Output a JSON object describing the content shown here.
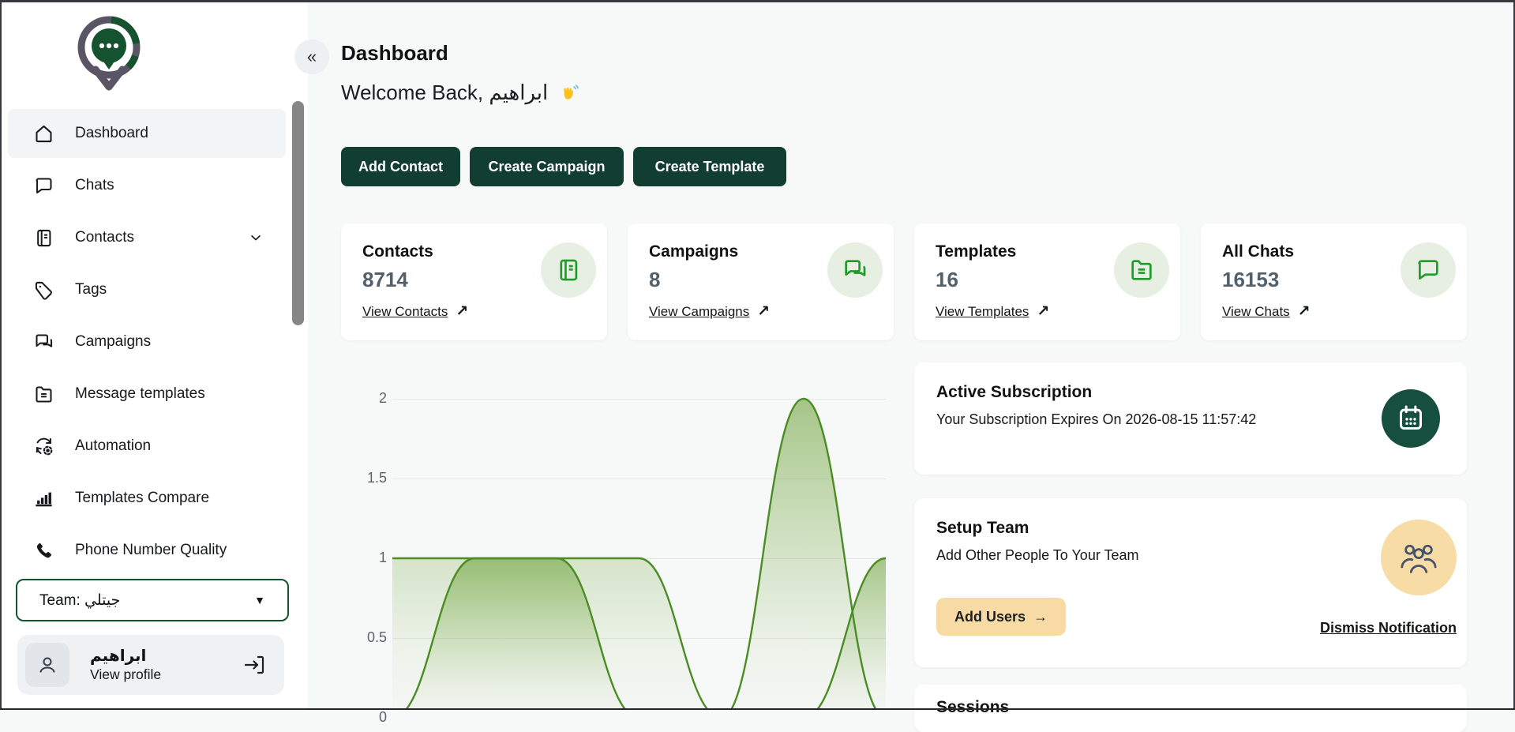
{
  "sidebar": {
    "items": [
      {
        "label": "Dashboard",
        "icon": "home-icon",
        "active": true
      },
      {
        "label": "Chats",
        "icon": "chat-icon"
      },
      {
        "label": "Contacts",
        "icon": "address-book-icon",
        "has_chevron": true
      },
      {
        "label": "Tags",
        "icon": "tag-icon"
      },
      {
        "label": "Campaigns",
        "icon": "double-chat-icon"
      },
      {
        "label": "Message templates",
        "icon": "folder-template-icon"
      },
      {
        "label": "Automation",
        "icon": "automation-gear-icon"
      },
      {
        "label": "Templates Compare",
        "icon": "bar-chart-icon"
      },
      {
        "label": "Phone Number Quality",
        "icon": "phone-icon"
      }
    ],
    "team_select": {
      "value": "Team: جيتلي"
    },
    "profile": {
      "name": "ابراهيم",
      "action": "View profile"
    }
  },
  "header": {
    "title": "Dashboard",
    "welcome": "Welcome Back, ابراهيم",
    "wave_icon": "👋",
    "collapse_icon": "«"
  },
  "actions": {
    "add_contact": "Add Contact",
    "create_campaign": "Create Campaign",
    "create_template": "Create Template"
  },
  "stats": [
    {
      "title": "Contacts",
      "value": "8714",
      "link": "View Contacts",
      "arrow": "↗",
      "icon": "contact-book-icon"
    },
    {
      "title": "Campaigns",
      "value": "8",
      "link": "View Campaigns",
      "arrow": "↗",
      "icon": "double-chat-icon"
    },
    {
      "title": "Templates",
      "value": "16",
      "link": "View Templates",
      "arrow": "↗",
      "icon": "folder-template-icon"
    },
    {
      "title": "All Chats",
      "value": "16153",
      "link": "View Chats",
      "arrow": "↗",
      "icon": "chat-bubble-icon"
    }
  ],
  "subscription": {
    "title": "Active Subscription",
    "text": "Your Subscription Expires On 2026-08-15 11:57:42",
    "icon": "calendar-icon"
  },
  "setup_team": {
    "title": "Setup Team",
    "text": "Add Other People To Your Team",
    "button": "Add Users",
    "button_arrow": "→",
    "dismiss": "Dismiss Notification",
    "icon": "people-group-icon"
  },
  "partial_card": {
    "title": "Sessions"
  },
  "chart_data": {
    "type": "area",
    "x": [
      0,
      1,
      2,
      3,
      4,
      5,
      6
    ],
    "x_labels_visible": false,
    "series": [
      {
        "name": "series_1",
        "values": [
          1,
          1,
          1,
          1,
          0,
          2,
          0
        ]
      },
      {
        "name": "series_2",
        "values": [
          0,
          1,
          1,
          0,
          0,
          0,
          1
        ]
      }
    ],
    "title": "",
    "xlabel": "",
    "ylabel": "",
    "ylim": [
      0,
      2
    ],
    "yticks": [
      0,
      0.5,
      1,
      1.5,
      2
    ],
    "grid": true,
    "legend": "hidden",
    "line_color": "#4c8c24",
    "fill_color": "#74a643",
    "grid_color": "#e6e8e8"
  },
  "colors": {
    "accent_dark_green": "#123e32",
    "logo_green": "#15532e",
    "logo_gray": "#5a5564",
    "icon_green": "#1f9b2c",
    "icon_circle_bg": "#e7efe2",
    "tan": "#f8dba4",
    "page_bg": "#f7f8f8",
    "sidebar_bg": "#ffffff"
  }
}
